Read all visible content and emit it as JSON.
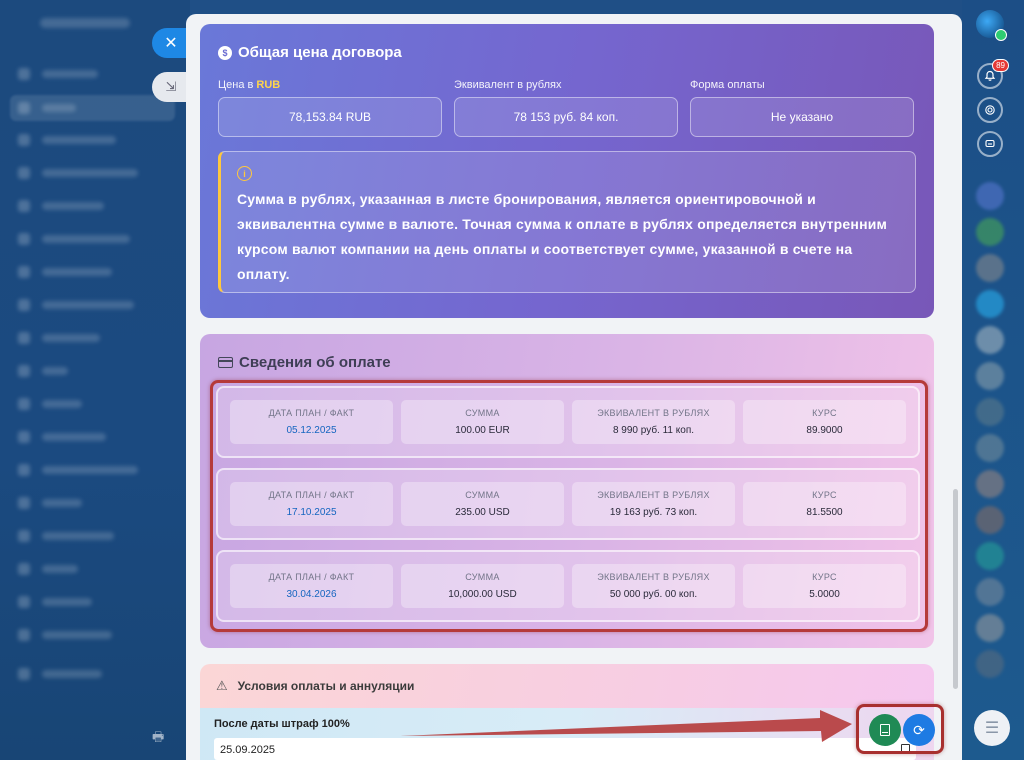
{
  "price_card": {
    "title": "Общая цена договора",
    "fields": [
      {
        "label": "Цена в",
        "currency": "RUB",
        "value": "78,153.84 RUB"
      },
      {
        "label": "Эквивалент в рублях",
        "currency": "",
        "value": "78 153 руб. 84 коп."
      },
      {
        "label": "Форма оплаты",
        "currency": "",
        "value": "Не указано"
      }
    ],
    "notice": "Сумма в рублях, указанная в листе бронирования, является ориентировочной и эквивалентна сумме в валюте. Точная сумма к оплате в рублях определяется внутренним курсом валют компании на день оплаты и соответствует сумме, указанной в счете на оплату."
  },
  "payment_card": {
    "title": "Сведения об оплате",
    "headers": {
      "date": "ДАТА ПЛАН / ФАКТ",
      "amount": "СУММА",
      "rub": "ЭКВИВАЛЕНТ В РУБЛЯХ",
      "rate": "КУРС"
    },
    "rows": [
      {
        "date": "05.12.2025",
        "amount": "100.00 EUR",
        "rub": "8 990 руб. 11 коп.",
        "rate": "89.9000"
      },
      {
        "date": "17.10.2025",
        "amount": "235.00 USD",
        "rub": "19 163 руб. 73 коп.",
        "rate": "81.5500"
      },
      {
        "date": "30.04.2026",
        "amount": "10,000.00 USD",
        "rub": "50 000 руб. 00 коп.",
        "rate": "5.0000"
      }
    ]
  },
  "conditions_card": {
    "title": "Условия оплаты и аннуляции",
    "penalty_label": "После даты штраф 100%",
    "penalty_date": "25.09.2025"
  },
  "right_bar": {
    "notifications_count": "89"
  },
  "colors": {
    "accent_blue": "#1e7be3",
    "pdf_green": "#1f8a55",
    "highlight_red": "#b53a3a",
    "notice_yellow": "#ffc83d"
  }
}
